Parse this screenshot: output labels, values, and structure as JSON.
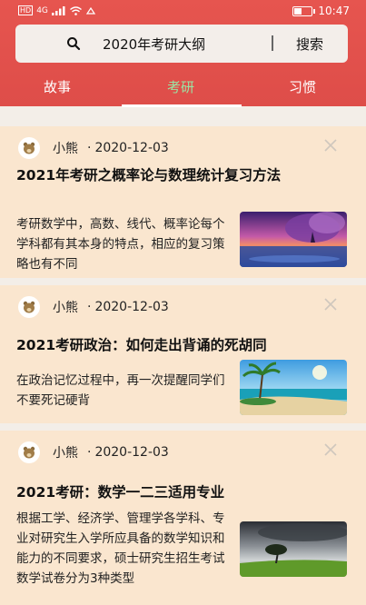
{
  "status_bar": {
    "time": "10:47",
    "network": "HD",
    "signal": "4G"
  },
  "search": {
    "query": "2020年考研大纲",
    "button_label": "搜索"
  },
  "tabs": [
    {
      "label": "故事",
      "active": false
    },
    {
      "label": "考研",
      "active": true
    },
    {
      "label": "习惯",
      "active": false
    }
  ],
  "colors": {
    "header": "#e0504b",
    "card": "#fae6cf",
    "active_tab": "#9ae4a4"
  },
  "articles": [
    {
      "author": "小熊",
      "separator": "·",
      "date": "2020-12-03",
      "title": "2021年考研之概率论与数理统计复习方法",
      "summary": "考研数学中，高数、线代、概率论每个学科都有其本身的特点，相应的复习策略也有不同",
      "thumbnail": "purple-tree-sunset-image"
    },
    {
      "author": "小熊",
      "separator": "·",
      "date": "2020-12-03",
      "title": "2021考研政治：如何走出背诵的死胡同",
      "summary": "在政治记忆过程中，再一次提醒同学们不要死记硬背",
      "thumbnail": "tropical-beach-image"
    },
    {
      "author": "小熊",
      "separator": "·",
      "date": "2020-12-03",
      "title": "2021考研：数学一二三适用专业",
      "summary": "根据工学、经济学、管理学各学科、专业对研究生入学所应具备的数学知识和能力的不同要求，硕士研究生招生考试数学试卷分为3种类型",
      "thumbnail": "stormy-tree-field-image"
    }
  ]
}
